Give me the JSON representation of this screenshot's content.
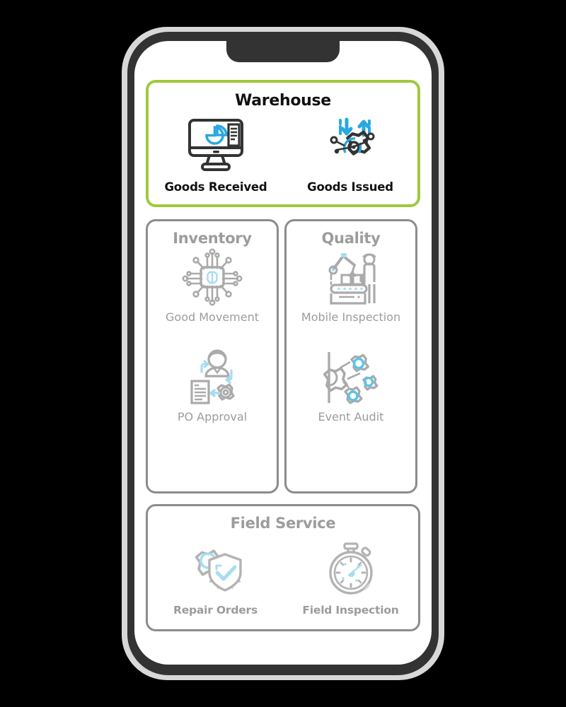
{
  "device": {
    "type": "smartphone-mockup",
    "frame_color": "#333333",
    "screen_background": "#ffffff"
  },
  "theme": {
    "accent_green": "#9fc93c",
    "muted_grey": "#9c9c9c",
    "border_grey": "#8c8c8c",
    "icon_blue": "#29a8e0",
    "icon_light_blue": "#a8ddf0",
    "icon_dark": "#333333",
    "text_dark": "#111111"
  },
  "app": {
    "cards": [
      {
        "id": "warehouse",
        "title": "Warehouse",
        "highlighted": true,
        "layout": "row",
        "tiles": [
          {
            "label": "Goods Received",
            "icon": "monitor-pie-chart-icon"
          },
          {
            "label": "Goods Issued",
            "icon": "gear-target-arrows-icon"
          }
        ]
      },
      {
        "id": "inventory",
        "title": "Inventory",
        "highlighted": false,
        "layout": "column",
        "tiles": [
          {
            "label": "Good Movement",
            "icon": "ai-chip-brain-icon"
          },
          {
            "label": "PO Approval",
            "icon": "person-document-gear-icon"
          }
        ]
      },
      {
        "id": "quality",
        "title": "Quality",
        "highlighted": false,
        "layout": "column",
        "tiles": [
          {
            "label": "Mobile Inspection",
            "icon": "robot-conveyor-worker-icon"
          },
          {
            "label": "Event Audit",
            "icon": "gears-cluster-icon"
          }
        ]
      },
      {
        "id": "fieldservice",
        "title": "Field Service",
        "highlighted": false,
        "layout": "row",
        "tiles": [
          {
            "label": "Repair Orders",
            "icon": "gear-shield-check-icon"
          },
          {
            "label": "Field Inspection",
            "icon": "stopwatch-icon"
          }
        ]
      }
    ]
  }
}
